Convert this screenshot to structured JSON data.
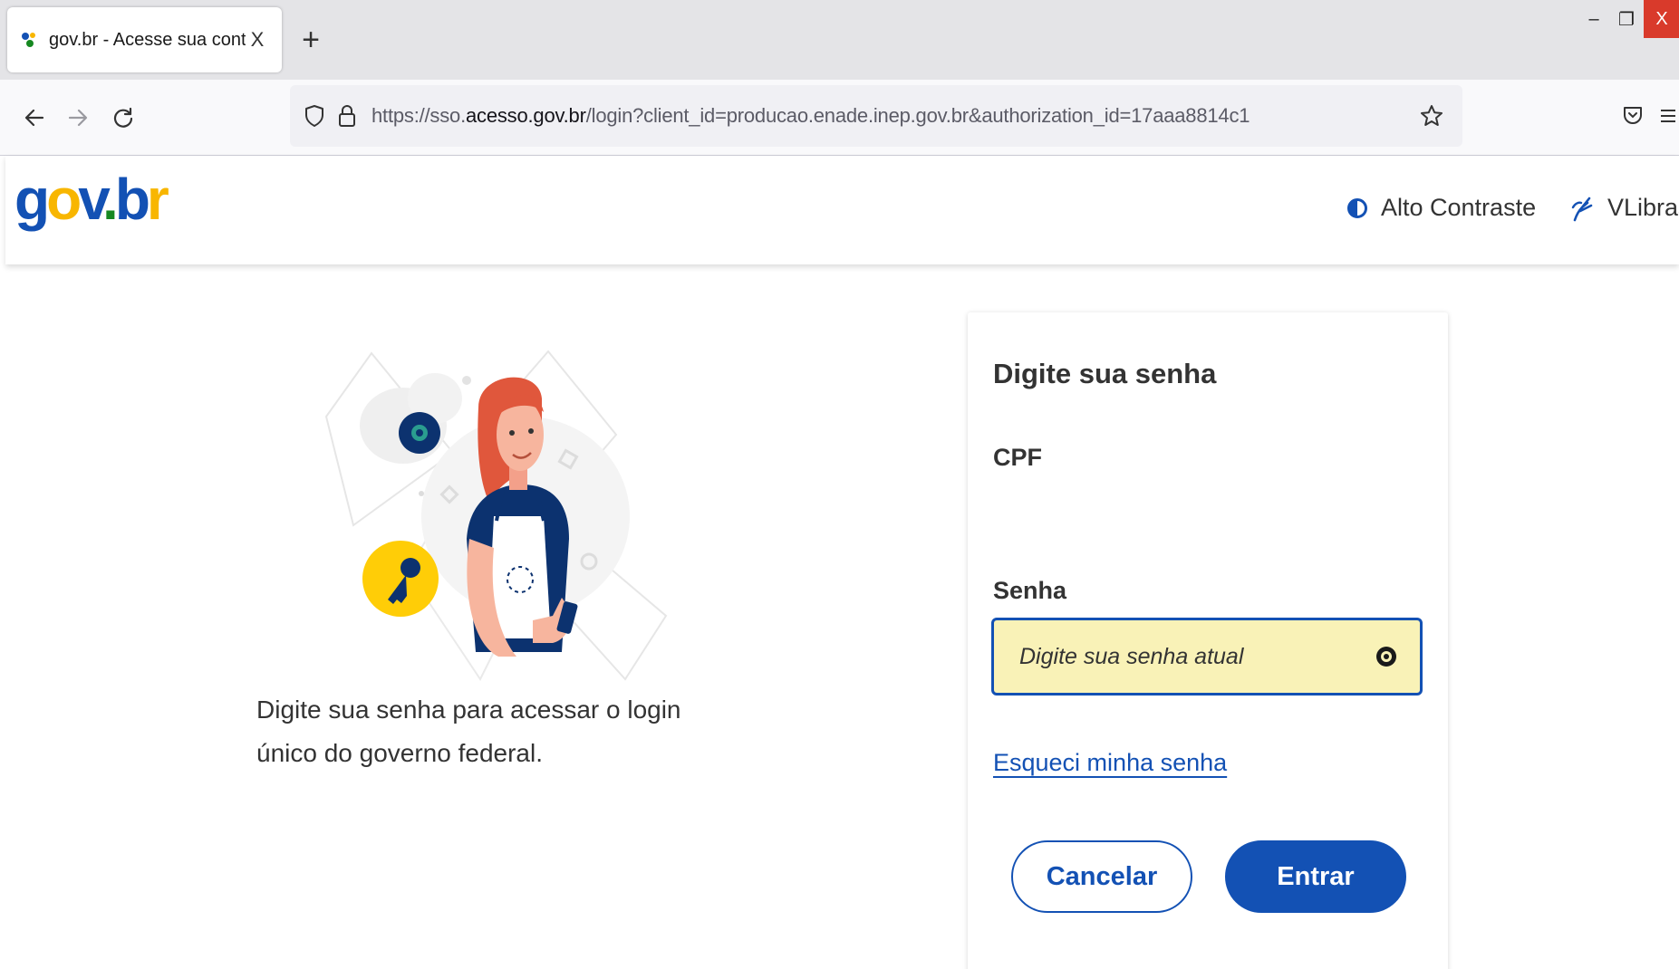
{
  "browser": {
    "tab_title": "gov.br - Acesse sua conta",
    "tab_close": "X",
    "new_tab": "+",
    "window": {
      "minimize": "–",
      "maximize": "❐",
      "close": "X"
    },
    "url_prefix": "https://sso.",
    "url_host": "acesso.gov.br",
    "url_path": "/login?client_id=producao.enade.inep.gov.br&authorization_id=17aaa8814c1"
  },
  "header": {
    "logo": {
      "g": "g",
      "o": "o",
      "v": "v",
      "dot": ".",
      "b": "b",
      "r": "r"
    },
    "contrast_label": "Alto Contraste",
    "vlibras_label": "VLibras"
  },
  "main": {
    "intro_text": "Digite sua senha para acessar o login único do governo federal."
  },
  "login": {
    "title": "Digite sua senha",
    "cpf_label": "CPF",
    "password_label": "Senha",
    "password_placeholder": "Digite sua senha atual",
    "password_value": "",
    "forgot_link": "Esqueci minha senha",
    "cancel_button": "Cancelar",
    "enter_button": "Entrar"
  },
  "colors": {
    "primary": "#1351b4",
    "input_bg": "#f9f2b7",
    "logo_yellow": "#f8b600",
    "logo_green": "#168821",
    "window_close": "#d93a2b"
  },
  "icons": [
    "gov-favicon-icon",
    "back-arrow-icon",
    "forward-arrow-icon",
    "reload-icon",
    "shield-icon",
    "lock-icon",
    "star-icon",
    "pocket-icon",
    "menu-icon",
    "contrast-icon",
    "vlibras-hand-icon",
    "eye-icon",
    "key-icon"
  ]
}
